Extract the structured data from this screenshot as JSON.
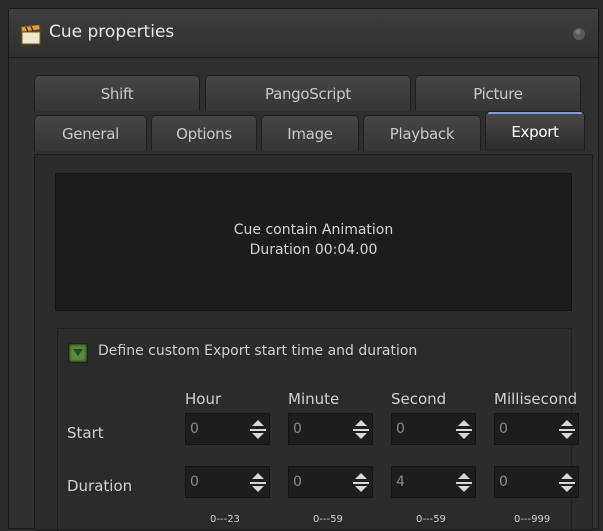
{
  "window": {
    "title": "Cue properties"
  },
  "tabs_row1": [
    "Shift",
    "PangoScript",
    "Picture"
  ],
  "tabs_row2": [
    "General",
    "Options",
    "Image",
    "Playback",
    "Export"
  ],
  "active_tab": "Export",
  "info": {
    "line1": "Cue contain Animation",
    "line2": "Duration 00:04.00"
  },
  "custom": {
    "checkbox_label": "Define custom Export start time and duration",
    "checked": true
  },
  "columns": [
    "Hour",
    "Minute",
    "Second",
    "Millisecond"
  ],
  "rows": {
    "start": {
      "label": "Start",
      "values": [
        "0",
        "0",
        "0",
        "0"
      ]
    },
    "duration": {
      "label": "Duration",
      "values": [
        "0",
        "0",
        "4",
        "0"
      ]
    }
  },
  "ranges": [
    "0---23",
    "0---59",
    "0---59",
    "0---999"
  ],
  "colors": {
    "checkbox": "#5a8a3a",
    "active_tab_accent": "#7aa0d8"
  }
}
